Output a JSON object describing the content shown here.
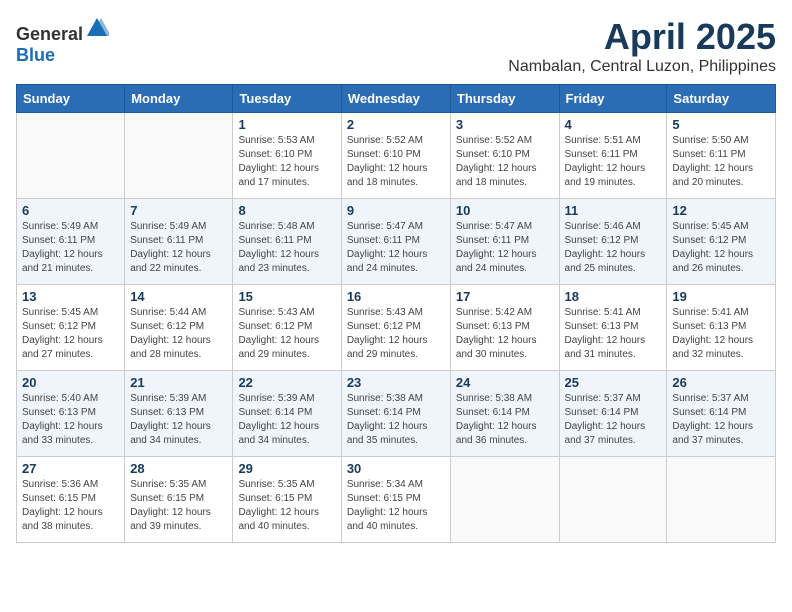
{
  "header": {
    "logo_general": "General",
    "logo_blue": "Blue",
    "title": "April 2025",
    "subtitle": "Nambalan, Central Luzon, Philippines"
  },
  "days_of_week": [
    "Sunday",
    "Monday",
    "Tuesday",
    "Wednesday",
    "Thursday",
    "Friday",
    "Saturday"
  ],
  "weeks": [
    [
      {
        "day": "",
        "sunrise": "",
        "sunset": "",
        "daylight": ""
      },
      {
        "day": "",
        "sunrise": "",
        "sunset": "",
        "daylight": ""
      },
      {
        "day": "1",
        "sunrise": "Sunrise: 5:53 AM",
        "sunset": "Sunset: 6:10 PM",
        "daylight": "Daylight: 12 hours and 17 minutes."
      },
      {
        "day": "2",
        "sunrise": "Sunrise: 5:52 AM",
        "sunset": "Sunset: 6:10 PM",
        "daylight": "Daylight: 12 hours and 18 minutes."
      },
      {
        "day": "3",
        "sunrise": "Sunrise: 5:52 AM",
        "sunset": "Sunset: 6:10 PM",
        "daylight": "Daylight: 12 hours and 18 minutes."
      },
      {
        "day": "4",
        "sunrise": "Sunrise: 5:51 AM",
        "sunset": "Sunset: 6:11 PM",
        "daylight": "Daylight: 12 hours and 19 minutes."
      },
      {
        "day": "5",
        "sunrise": "Sunrise: 5:50 AM",
        "sunset": "Sunset: 6:11 PM",
        "daylight": "Daylight: 12 hours and 20 minutes."
      }
    ],
    [
      {
        "day": "6",
        "sunrise": "Sunrise: 5:49 AM",
        "sunset": "Sunset: 6:11 PM",
        "daylight": "Daylight: 12 hours and 21 minutes."
      },
      {
        "day": "7",
        "sunrise": "Sunrise: 5:49 AM",
        "sunset": "Sunset: 6:11 PM",
        "daylight": "Daylight: 12 hours and 22 minutes."
      },
      {
        "day": "8",
        "sunrise": "Sunrise: 5:48 AM",
        "sunset": "Sunset: 6:11 PM",
        "daylight": "Daylight: 12 hours and 23 minutes."
      },
      {
        "day": "9",
        "sunrise": "Sunrise: 5:47 AM",
        "sunset": "Sunset: 6:11 PM",
        "daylight": "Daylight: 12 hours and 24 minutes."
      },
      {
        "day": "10",
        "sunrise": "Sunrise: 5:47 AM",
        "sunset": "Sunset: 6:11 PM",
        "daylight": "Daylight: 12 hours and 24 minutes."
      },
      {
        "day": "11",
        "sunrise": "Sunrise: 5:46 AM",
        "sunset": "Sunset: 6:12 PM",
        "daylight": "Daylight: 12 hours and 25 minutes."
      },
      {
        "day": "12",
        "sunrise": "Sunrise: 5:45 AM",
        "sunset": "Sunset: 6:12 PM",
        "daylight": "Daylight: 12 hours and 26 minutes."
      }
    ],
    [
      {
        "day": "13",
        "sunrise": "Sunrise: 5:45 AM",
        "sunset": "Sunset: 6:12 PM",
        "daylight": "Daylight: 12 hours and 27 minutes."
      },
      {
        "day": "14",
        "sunrise": "Sunrise: 5:44 AM",
        "sunset": "Sunset: 6:12 PM",
        "daylight": "Daylight: 12 hours and 28 minutes."
      },
      {
        "day": "15",
        "sunrise": "Sunrise: 5:43 AM",
        "sunset": "Sunset: 6:12 PM",
        "daylight": "Daylight: 12 hours and 29 minutes."
      },
      {
        "day": "16",
        "sunrise": "Sunrise: 5:43 AM",
        "sunset": "Sunset: 6:12 PM",
        "daylight": "Daylight: 12 hours and 29 minutes."
      },
      {
        "day": "17",
        "sunrise": "Sunrise: 5:42 AM",
        "sunset": "Sunset: 6:13 PM",
        "daylight": "Daylight: 12 hours and 30 minutes."
      },
      {
        "day": "18",
        "sunrise": "Sunrise: 5:41 AM",
        "sunset": "Sunset: 6:13 PM",
        "daylight": "Daylight: 12 hours and 31 minutes."
      },
      {
        "day": "19",
        "sunrise": "Sunrise: 5:41 AM",
        "sunset": "Sunset: 6:13 PM",
        "daylight": "Daylight: 12 hours and 32 minutes."
      }
    ],
    [
      {
        "day": "20",
        "sunrise": "Sunrise: 5:40 AM",
        "sunset": "Sunset: 6:13 PM",
        "daylight": "Daylight: 12 hours and 33 minutes."
      },
      {
        "day": "21",
        "sunrise": "Sunrise: 5:39 AM",
        "sunset": "Sunset: 6:13 PM",
        "daylight": "Daylight: 12 hours and 34 minutes."
      },
      {
        "day": "22",
        "sunrise": "Sunrise: 5:39 AM",
        "sunset": "Sunset: 6:14 PM",
        "daylight": "Daylight: 12 hours and 34 minutes."
      },
      {
        "day": "23",
        "sunrise": "Sunrise: 5:38 AM",
        "sunset": "Sunset: 6:14 PM",
        "daylight": "Daylight: 12 hours and 35 minutes."
      },
      {
        "day": "24",
        "sunrise": "Sunrise: 5:38 AM",
        "sunset": "Sunset: 6:14 PM",
        "daylight": "Daylight: 12 hours and 36 minutes."
      },
      {
        "day": "25",
        "sunrise": "Sunrise: 5:37 AM",
        "sunset": "Sunset: 6:14 PM",
        "daylight": "Daylight: 12 hours and 37 minutes."
      },
      {
        "day": "26",
        "sunrise": "Sunrise: 5:37 AM",
        "sunset": "Sunset: 6:14 PM",
        "daylight": "Daylight: 12 hours and 37 minutes."
      }
    ],
    [
      {
        "day": "27",
        "sunrise": "Sunrise: 5:36 AM",
        "sunset": "Sunset: 6:15 PM",
        "daylight": "Daylight: 12 hours and 38 minutes."
      },
      {
        "day": "28",
        "sunrise": "Sunrise: 5:35 AM",
        "sunset": "Sunset: 6:15 PM",
        "daylight": "Daylight: 12 hours and 39 minutes."
      },
      {
        "day": "29",
        "sunrise": "Sunrise: 5:35 AM",
        "sunset": "Sunset: 6:15 PM",
        "daylight": "Daylight: 12 hours and 40 minutes."
      },
      {
        "day": "30",
        "sunrise": "Sunrise: 5:34 AM",
        "sunset": "Sunset: 6:15 PM",
        "daylight": "Daylight: 12 hours and 40 minutes."
      },
      {
        "day": "",
        "sunrise": "",
        "sunset": "",
        "daylight": ""
      },
      {
        "day": "",
        "sunrise": "",
        "sunset": "",
        "daylight": ""
      },
      {
        "day": "",
        "sunrise": "",
        "sunset": "",
        "daylight": ""
      }
    ]
  ]
}
